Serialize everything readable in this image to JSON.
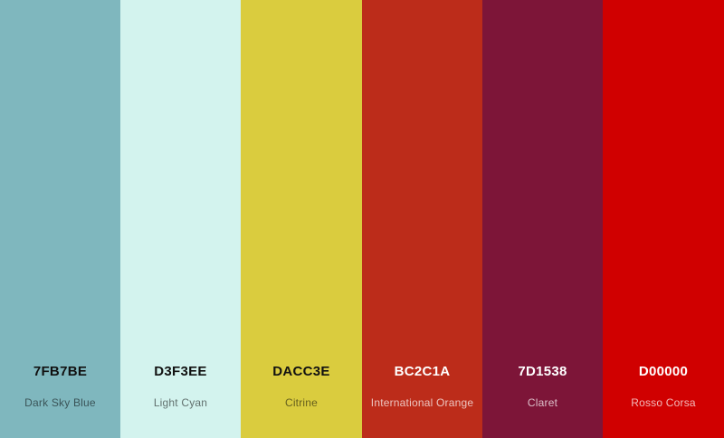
{
  "palette": {
    "colors": [
      {
        "hex": "7FB7BE",
        "name": "Dark Sky Blue",
        "color": "#7FB7BE"
      },
      {
        "hex": "D3F3EE",
        "name": "Light Cyan",
        "color": "#D3F3EE"
      },
      {
        "hex": "DACC3E",
        "name": "Citrine",
        "color": "#DACC3E"
      },
      {
        "hex": "BC2C1A",
        "name": "International Orange",
        "color": "#BC2C1A"
      },
      {
        "hex": "7D1538",
        "name": "Claret",
        "color": "#7D1538"
      },
      {
        "hex": "D00000",
        "name": "Rosso Corsa",
        "color": "#D00000"
      }
    ]
  }
}
